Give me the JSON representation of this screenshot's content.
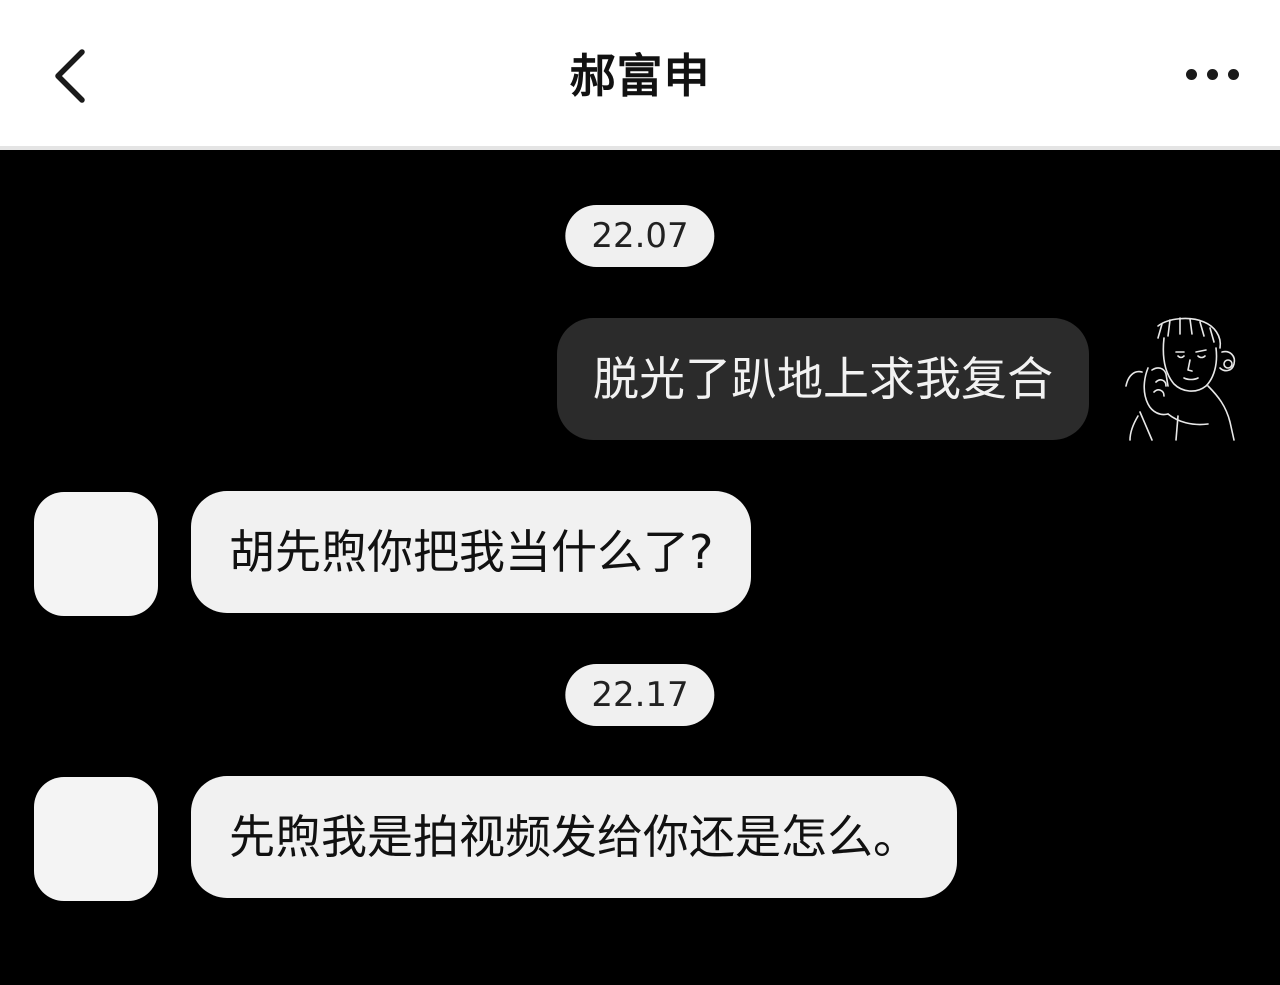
{
  "header": {
    "title": "郝富申",
    "back_icon": "chevron-left-icon",
    "more_icon": "more-horizontal-icon"
  },
  "messages": [
    {
      "type": "time",
      "text": "22.07"
    },
    {
      "type": "outgoing",
      "text": "脱光了趴地上求我复合"
    },
    {
      "type": "incoming",
      "text": "胡先煦你把我当什么了?"
    },
    {
      "type": "time",
      "text": "22.17"
    },
    {
      "type": "incoming",
      "text": "先煦我是拍视频发给你还是怎么。"
    }
  ],
  "colors": {
    "header_bg": "#ffffff",
    "chat_bg": "#000000",
    "outgoing_bubble": "#2b2b2b",
    "incoming_bubble": "#f1f1f1",
    "time_pill": "#f0f0f0"
  }
}
